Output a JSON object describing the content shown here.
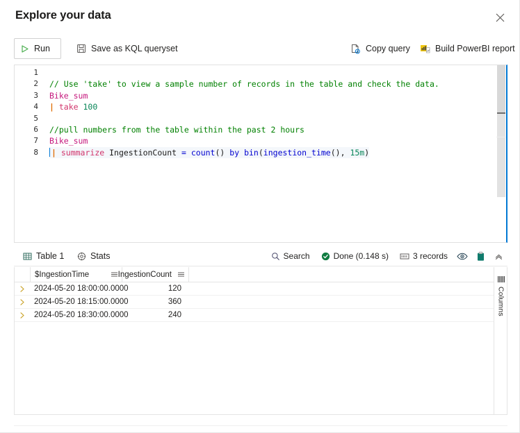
{
  "dialog": {
    "title": "Explore your data",
    "close_label": "Close",
    "close_icon": "close-icon"
  },
  "toolbar": {
    "run_label": "Run",
    "run_icon": "play-icon",
    "save_label": "Save as KQL queryset",
    "save_icon": "save-disk-icon",
    "copy_label": "Copy query",
    "copy_icon": "copy-query-icon",
    "powerbi_label": "Build PowerBI report",
    "powerbi_icon": "powerbi-report-icon"
  },
  "editor": {
    "language": "kql",
    "lines": [
      {
        "n": "1",
        "segments": []
      },
      {
        "n": "2",
        "segments": [
          {
            "t": "// Use 'take' to view a sample number of records in the table and check the data.",
            "c": "tk-comment"
          }
        ]
      },
      {
        "n": "3",
        "segments": [
          {
            "t": "Bike_sum",
            "c": "tk-table"
          }
        ]
      },
      {
        "n": "4",
        "segments": [
          {
            "t": "| ",
            "c": "tk-pipe"
          },
          {
            "t": "take",
            "c": "tk-kw"
          },
          {
            "t": " ",
            "c": "tk-punc"
          },
          {
            "t": "100",
            "c": "tk-num"
          }
        ]
      },
      {
        "n": "5",
        "segments": []
      },
      {
        "n": "6",
        "segments": [
          {
            "t": "//pull numbers from the table within the past 2 hours",
            "c": "tk-comment"
          }
        ]
      },
      {
        "n": "7",
        "segments": [
          {
            "t": "Bike_sum",
            "c": "tk-table"
          }
        ]
      },
      {
        "n": "8",
        "current": true,
        "caret": true,
        "segments": [
          {
            "t": "| ",
            "c": "tk-pipe"
          },
          {
            "t": "summarize",
            "c": "tk-kw"
          },
          {
            "t": " ",
            "c": "tk-punc"
          },
          {
            "t": "IngestionCount",
            "c": "tk-ident"
          },
          {
            "t": " ",
            "c": "tk-punc"
          },
          {
            "t": "=",
            "c": "tk-eq"
          },
          {
            "t": " ",
            "c": "tk-punc"
          },
          {
            "t": "count",
            "c": "tk-func"
          },
          {
            "t": "()",
            "c": "tk-punc"
          },
          {
            "t": " ",
            "c": "tk-punc"
          },
          {
            "t": "by",
            "c": "tk-eq"
          },
          {
            "t": " ",
            "c": "tk-punc"
          },
          {
            "t": "bin",
            "c": "tk-func"
          },
          {
            "t": "(",
            "c": "tk-punc"
          },
          {
            "t": "ingestion_time",
            "c": "tk-func"
          },
          {
            "t": "()",
            "c": "tk-punc"
          },
          {
            "t": ", ",
            "c": "tk-punc"
          },
          {
            "t": "15m",
            "c": "tk-num"
          },
          {
            "t": ")",
            "c": "tk-punc"
          }
        ]
      }
    ]
  },
  "results": {
    "tabs": [
      {
        "label": "Table 1",
        "icon": "table-icon",
        "active": true
      },
      {
        "label": "Stats",
        "icon": "stats-target-icon",
        "active": false
      }
    ],
    "search_label": "Search",
    "search_icon": "search-icon",
    "status_label": "Done (0.148 s)",
    "status_icon": "check-circle-icon",
    "status_color": "#107c41",
    "records_label": "3 records",
    "records_icon": "records-icon",
    "eye_icon": "eye-visible-icon",
    "clipboard_icon": "clipboard-icon",
    "clipboard_color": "#0f7b6c",
    "collapse_icon": "chevron-up-icon"
  },
  "grid": {
    "columns": [
      {
        "name": "$IngestionTime",
        "menu_icon": "column-menu-icon"
      },
      {
        "name": "IngestionCount",
        "menu_icon": "column-menu-icon"
      }
    ],
    "rows": [
      {
        "expand_icon": "chevron-right-icon",
        "ingestion_time": "2024-05-20 18:00:00.0000",
        "ingestion_count": "120"
      },
      {
        "expand_icon": "chevron-right-icon",
        "ingestion_time": "2024-05-20 18:15:00.0000",
        "ingestion_count": "360"
      },
      {
        "expand_icon": "chevron-right-icon",
        "ingestion_time": "2024-05-20 18:30:00.0000",
        "ingestion_count": "240"
      }
    ],
    "side_panel": {
      "label": "Columns",
      "icon": "columns-icon"
    }
  },
  "colors": {
    "accent": "#0078d4",
    "tab_underline": "#107c6e",
    "success": "#107c41",
    "run_play": "#4caf50"
  }
}
